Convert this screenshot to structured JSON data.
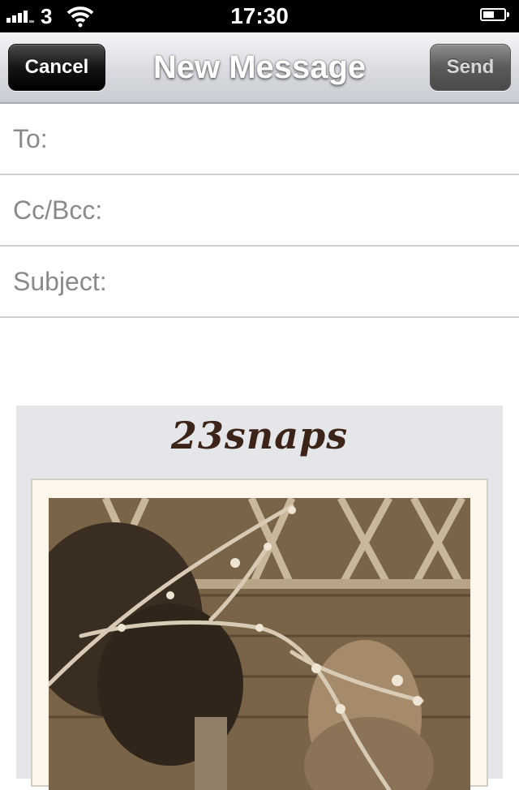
{
  "status_bar": {
    "carrier": "3",
    "time": "17:30"
  },
  "nav": {
    "cancel_label": "Cancel",
    "title": "New Message",
    "send_label": "Send"
  },
  "fields": {
    "to_label": "To:",
    "cc_label": "Cc/Bcc:",
    "subject_label": "Subject:"
  },
  "body": {
    "brand": "23snaps"
  },
  "icons": {
    "signal": "signal-bars-icon",
    "wifi": "wifi-icon",
    "battery": "battery-icon"
  },
  "colors": {
    "status_bg": "#000000",
    "nav_gradient_top": "#f4f5f7",
    "nav_gradient_bottom": "#c9ccd2",
    "card_bg": "#e5e6ea",
    "brand_color": "#3c2418",
    "photo_tint": "#8a7357"
  }
}
